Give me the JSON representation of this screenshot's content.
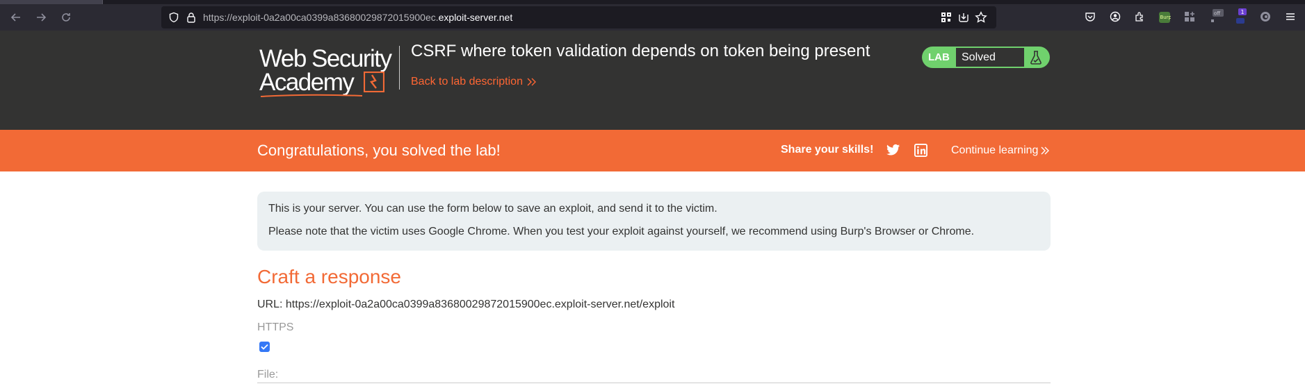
{
  "browser": {
    "url_prefix": "https://exploit-0a2a00ca0399a83680029872015900ec.",
    "url_host": "exploit-server.net"
  },
  "header": {
    "logo_line1": "Web Security",
    "logo_line2": "Academy",
    "lab_title": "CSRF where token validation depends on token being present",
    "back_link": "Back to lab description",
    "status_label": "LAB",
    "status_value": "Solved"
  },
  "banner": {
    "congrats": "Congratulations, you solved the lab!",
    "share": "Share your skills!",
    "continue": "Continue learning"
  },
  "info": {
    "line1": "This is your server. You can use the form below to save an exploit, and send it to the victim.",
    "line2": "Please note that the victim uses Google Chrome. When you test your exploit against yourself, we recommend using Burp's Browser or Chrome."
  },
  "form": {
    "section_title": "Craft a response",
    "url_line": "URL: https://exploit-0a2a00ca0399a83680029872015900ec.exploit-server.net/exploit",
    "https_label": "HTTPS",
    "https_checked": true,
    "file_label": "File:"
  },
  "colors": {
    "accent": "#f26a36",
    "header_bg": "#333332",
    "solved_green": "#70d16d"
  }
}
